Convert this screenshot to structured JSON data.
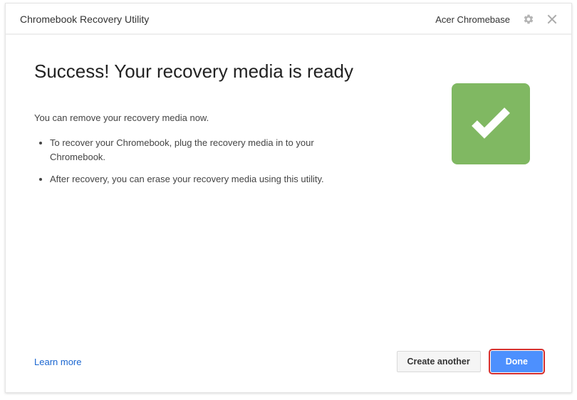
{
  "header": {
    "app_title": "Chromebook Recovery Utility",
    "device": "Acer Chromebase"
  },
  "main": {
    "title": "Success! Your recovery media is ready",
    "intro": "You can remove your recovery media now.",
    "steps": [
      "To recover your Chromebook, plug the recovery media in to your Chromebook.",
      "After recovery, you can erase your recovery media using this utility."
    ]
  },
  "footer": {
    "learn_more": "Learn more",
    "create_another": "Create another",
    "done": "Done"
  },
  "colors": {
    "success_bg": "#80b862",
    "primary_btn": "#4d90fe",
    "link": "#1a66d0"
  }
}
